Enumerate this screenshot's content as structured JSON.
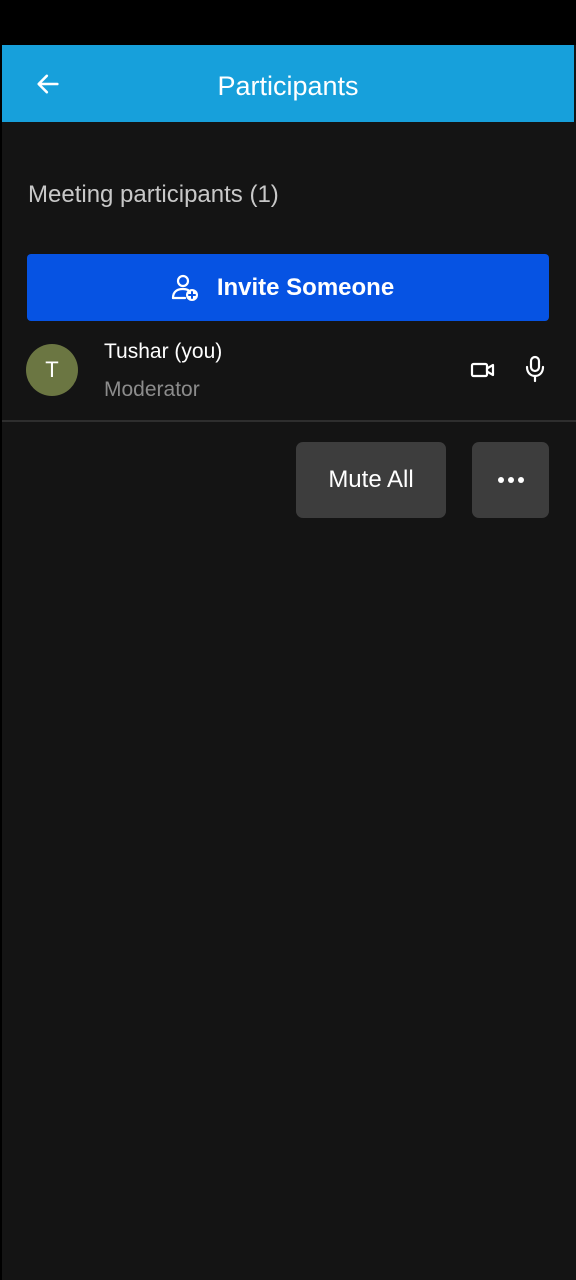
{
  "header": {
    "title": "Participants",
    "back_icon": "arrow-left-icon"
  },
  "section": {
    "title": "Meeting participants (1)"
  },
  "invite": {
    "label": "Invite Someone",
    "icon": "add-person-icon"
  },
  "participants": [
    {
      "initial": "T",
      "name": "Tushar (you)",
      "role": "Moderator",
      "avatar_color": "#6b7642",
      "video_icon": "camera-icon",
      "audio_icon": "microphone-icon"
    }
  ],
  "actions": {
    "mute_all_label": "Mute All",
    "more_icon": "more-horizontal-icon"
  },
  "colors": {
    "app_bar": "#17a0db",
    "invite_button": "#0653e3",
    "background": "#141414",
    "secondary_button": "#3d3d3d"
  }
}
